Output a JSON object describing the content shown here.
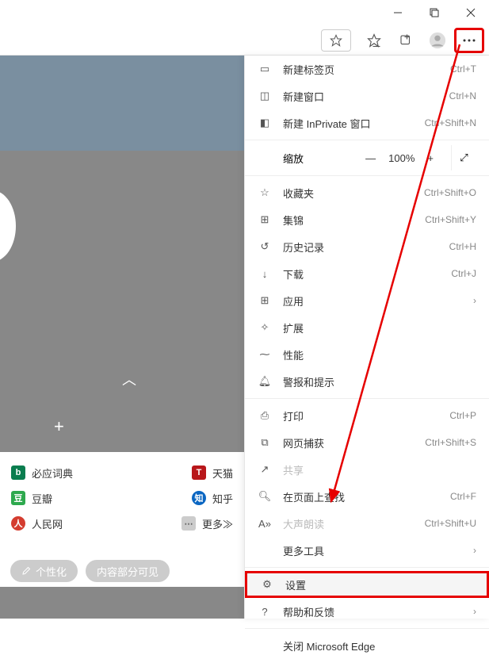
{
  "menu": {
    "new_tab": "新建标签页",
    "new_tab_sc": "Ctrl+T",
    "new_window": "新建窗口",
    "new_window_sc": "Ctrl+N",
    "new_inprivate": "新建 InPrivate 窗口",
    "new_inprivate_sc": "Ctrl+Shift+N",
    "zoom": "缩放",
    "zoom_pct": "100%",
    "favorites": "收藏夹",
    "favorites_sc": "Ctrl+Shift+O",
    "collections": "集锦",
    "collections_sc": "Ctrl+Shift+Y",
    "history": "历史记录",
    "history_sc": "Ctrl+H",
    "downloads": "下载",
    "downloads_sc": "Ctrl+J",
    "apps": "应用",
    "extensions": "扩展",
    "performance": "性能",
    "alerts": "警报和提示",
    "print": "打印",
    "print_sc": "Ctrl+P",
    "capture": "网页捕获",
    "capture_sc": "Ctrl+Shift+S",
    "share": "共享",
    "find": "在页面上查找",
    "find_sc": "Ctrl+F",
    "read_aloud": "大声朗读",
    "read_aloud_sc": "Ctrl+Shift+U",
    "more_tools": "更多工具",
    "settings": "设置",
    "help": "帮助和反馈",
    "close": "关闭 Microsoft Edge"
  },
  "quicklinks": {
    "bing_dict": "必应词典",
    "tmall": "天猫",
    "douban": "豆瓣",
    "zhihu": "知乎",
    "renmin": "人民网",
    "more": "更多"
  },
  "pills": {
    "personalize": "个性化",
    "content_visible": "内容部分可见"
  }
}
